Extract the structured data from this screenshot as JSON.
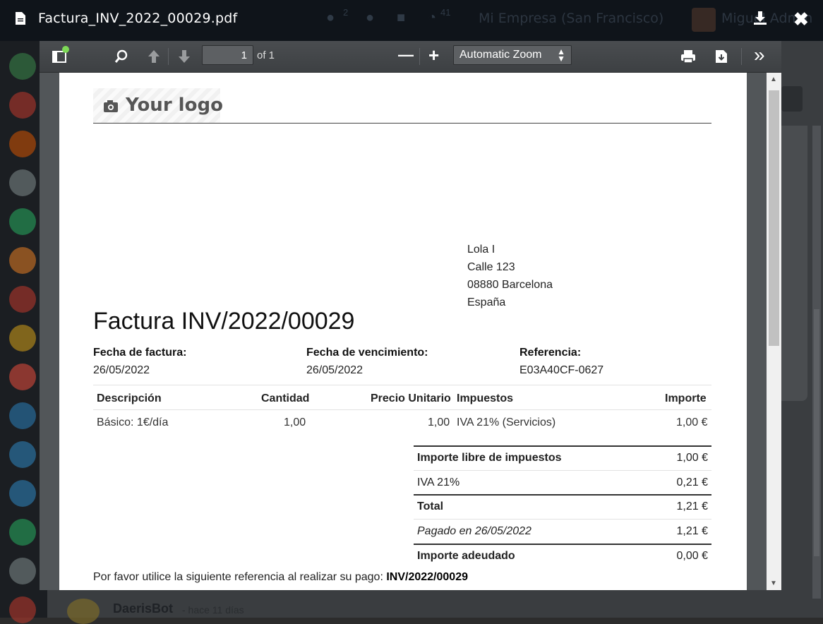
{
  "window": {
    "file_title": "Factura_INV_2022_00029.pdf",
    "close_glyph": "✖"
  },
  "background": {
    "company": "Mi Empresa (San Francisco)",
    "user": "Miguel Admin",
    "chat_badge": "2",
    "activity_badge": "41",
    "chatter_author": "DaerisBot",
    "chatter_time": "- hace 11 días"
  },
  "toolbar": {
    "page_number": "1",
    "page_count": "of 1",
    "zoom_minus": "—",
    "zoom_plus": "+",
    "zoom_label": "Automatic Zoom",
    "more_tools": "»"
  },
  "invoice": {
    "logo_text": "Your logo",
    "customer": {
      "name": "Lola I",
      "street": "Calle 123",
      "city": "08880 Barcelona",
      "country": "España"
    },
    "title": "Factura INV/2022/00029",
    "meta": {
      "date_label": "Fecha de factura:",
      "date_value": "26/05/2022",
      "due_label": "Fecha de vencimiento:",
      "due_value": "26/05/2022",
      "ref_label": "Referencia:",
      "ref_value": "E03A40CF-0627"
    },
    "table": {
      "headers": [
        "Descripción",
        "Cantidad",
        "Precio Unitario",
        "Impuestos",
        "Importe"
      ],
      "rows": [
        [
          "Básico: 1€/día",
          "1,00",
          "1,00",
          "IVA 21% (Servicios)",
          "1,00 €"
        ]
      ]
    },
    "totals": [
      {
        "label": "Importe libre de impuestos",
        "value": "1,00 €"
      },
      {
        "label": "IVA 21%",
        "value": "0,21 €"
      },
      {
        "label": "Total",
        "value": "1,21 €"
      },
      {
        "label": "Pagado en 26/05/2022",
        "value": "1,21 €"
      },
      {
        "label": "Importe adeudado",
        "value": "0,00 €"
      }
    ],
    "payment_note": "Por favor utilice la siguiente referencia al realizar su pago:",
    "payment_ref": "INV/2022/00029"
  },
  "colors": {
    "topbar": "#0f141a",
    "toolbar": "#3d4043",
    "viewer_bg": "#525659",
    "status_dot": "#7ed957"
  },
  "icons": [
    "file-icon",
    "download-icon",
    "close-icon",
    "sidebar-toggle-icon",
    "search-icon",
    "arrow-up-icon",
    "arrow-down-icon",
    "zoom-out-icon",
    "zoom-in-icon",
    "print-icon",
    "save-icon",
    "tools-menu-icon",
    "camera-icon"
  ]
}
